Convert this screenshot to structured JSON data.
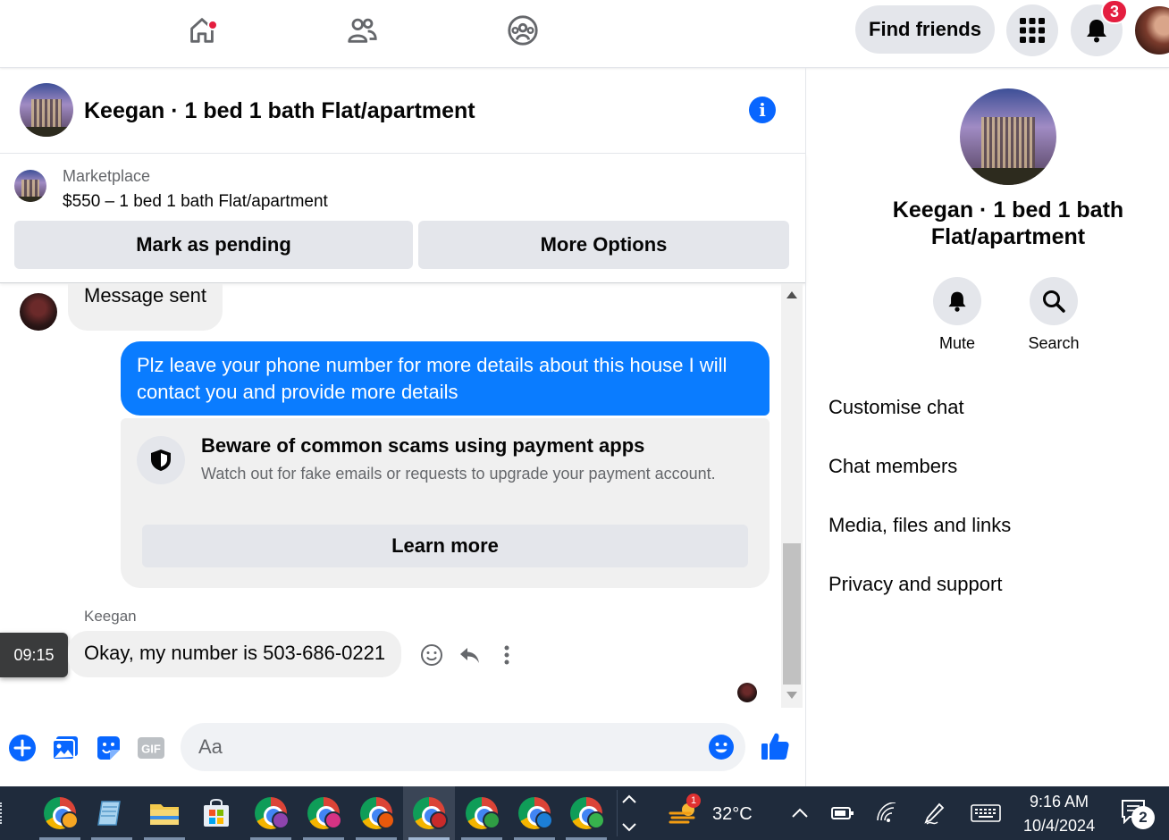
{
  "nav": {
    "find_friends_label": "Find friends",
    "notifications_count": "3",
    "colors": {
      "accent": "#0866ff",
      "badge": "#e41e3f"
    }
  },
  "chat": {
    "title": "Keegan · 1 bed 1 bath Flat/apartment"
  },
  "marketplace": {
    "label": "Marketplace",
    "listing": "$550 – 1 bed 1 bath Flat/apartment",
    "mark_pending_label": "Mark as pending",
    "more_options_label": "More Options"
  },
  "messages": {
    "first_incoming": "Message sent",
    "outgoing": "Plz leave your phone number for more details about this house I will contact you and provide more details",
    "scam_title": "Beware of common scams using payment apps",
    "scam_desc": "Watch out for fake emails or requests to upgrade your payment account.",
    "learn_more_label": "Learn more",
    "sender_name": "Keegan",
    "time": "09:15",
    "reply": "Okay, my number is 503-686-0221"
  },
  "composer": {
    "placeholder": "Aa",
    "gif_label": "GIF"
  },
  "right_panel": {
    "name_line1": "Keegan · 1 bed 1 bath",
    "name_line2": "Flat/apartment",
    "mute_label": "Mute",
    "search_label": "Search",
    "menu": [
      "Customise chat",
      "Chat members",
      "Media, files and links",
      "Privacy and support"
    ]
  },
  "taskbar": {
    "weather_badge": "1",
    "temperature": "32°C",
    "time": "9:16 AM",
    "date": "10/4/2024",
    "notification_count": "2",
    "profile_colors": [
      "#f6a623",
      "#8e44ad",
      "#d63384",
      "#e8590c",
      "#c92a2a",
      "#2f9e44",
      "#1c7ed6",
      "#37b24d"
    ]
  }
}
